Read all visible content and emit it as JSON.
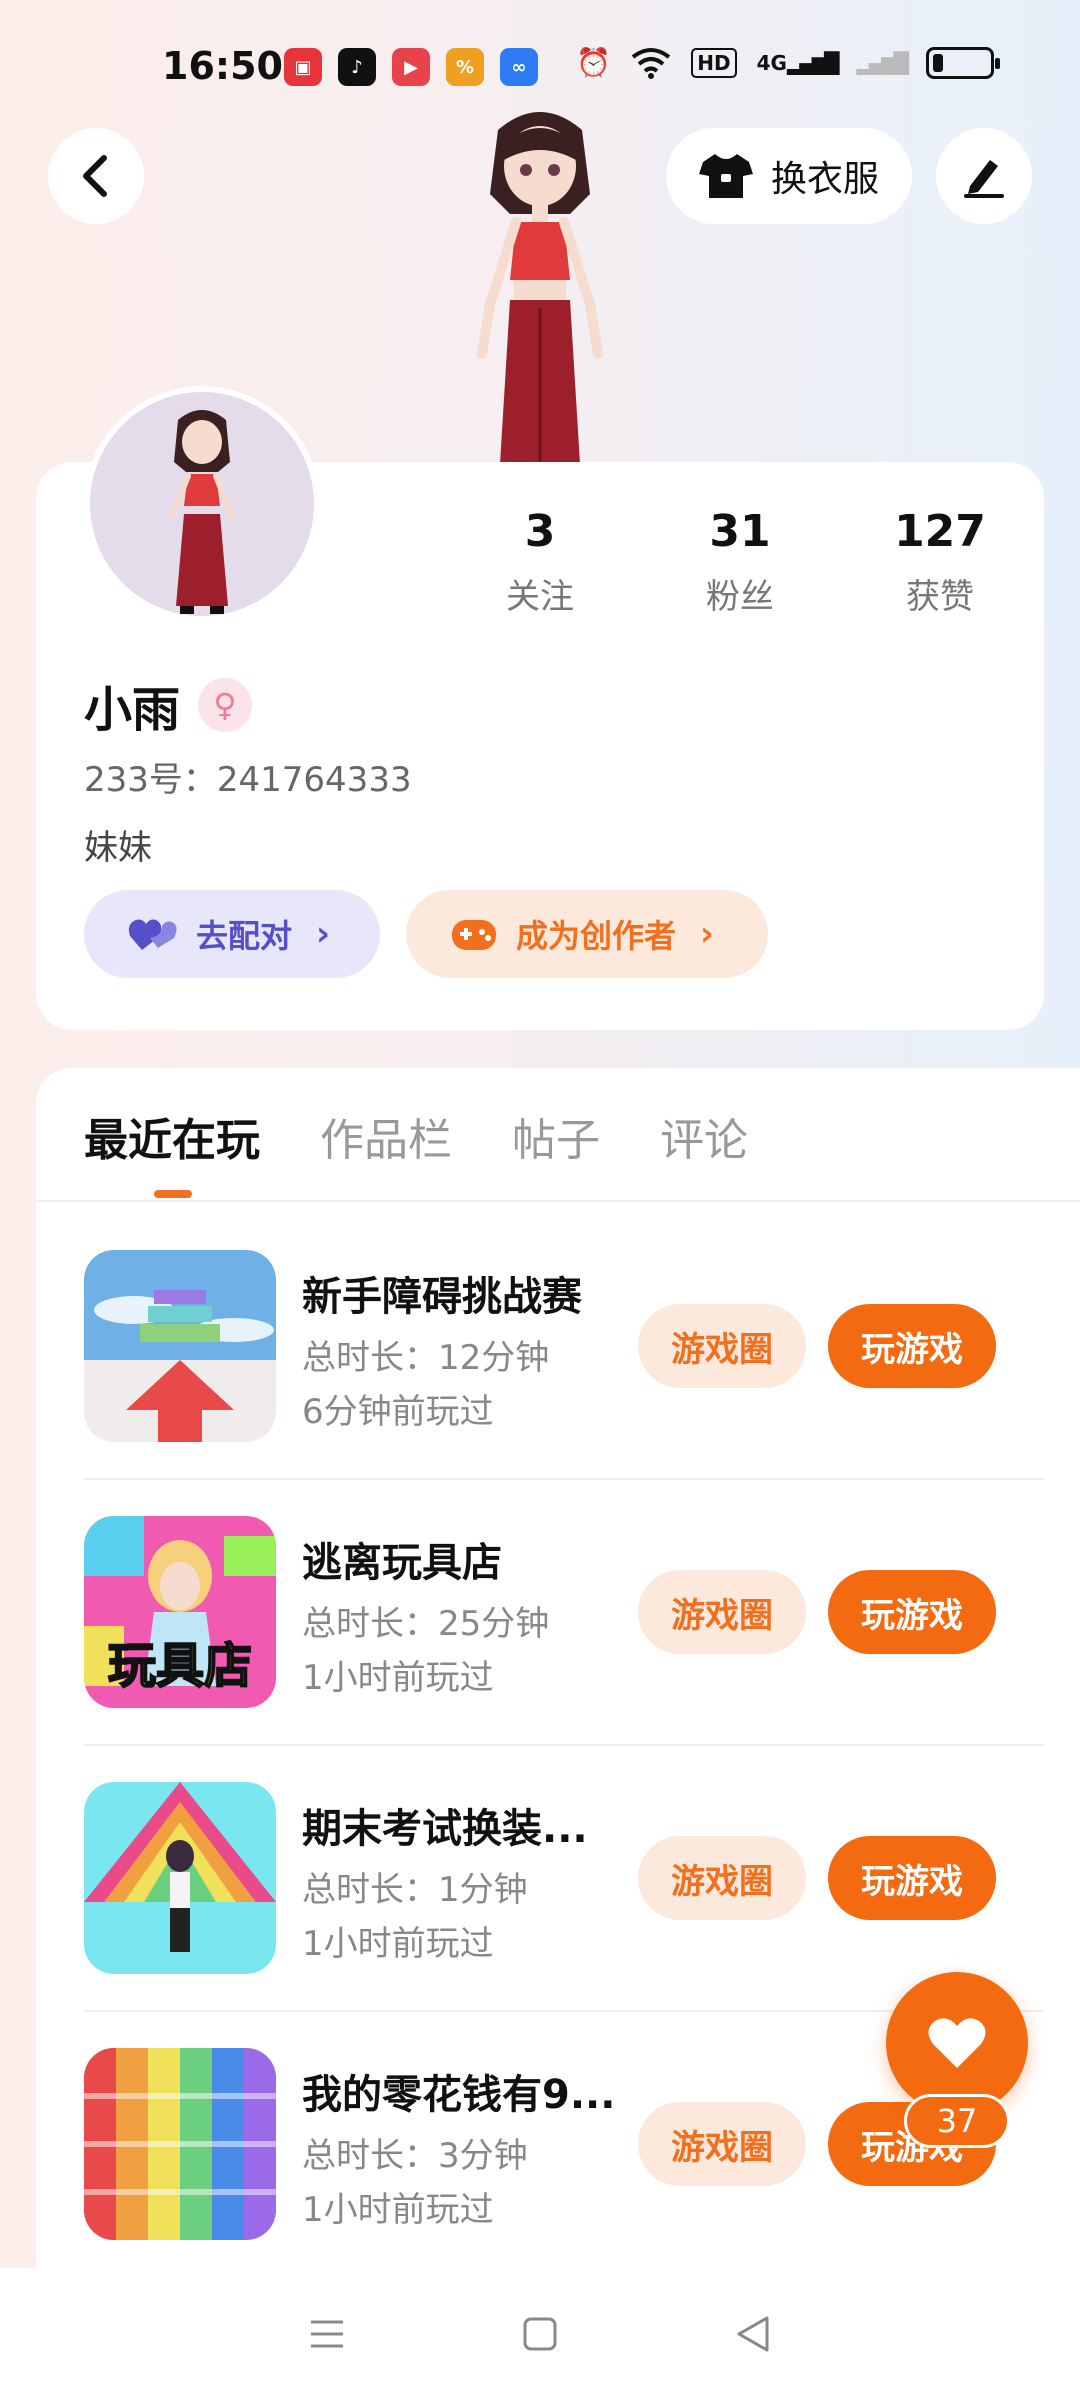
{
  "status_bar": {
    "time": "16:50",
    "apps": [
      {
        "icon": "store-app-icon",
        "color": "#e6343a"
      },
      {
        "icon": "tiktok-icon",
        "color": "#111111"
      },
      {
        "icon": "video-app-icon",
        "color": "#e8424a"
      },
      {
        "icon": "coupon-app-icon",
        "color": "#f0a020"
      },
      {
        "icon": "infinity-app-icon",
        "color": "#2d7cf6"
      }
    ],
    "hd_label": "HD",
    "network_label": "4G"
  },
  "header": {
    "outfit_label": "换衣服"
  },
  "profile": {
    "name": "小雨",
    "id_text": "233号：241764333",
    "bio": "妹妹",
    "stats": [
      {
        "value": "3",
        "label": "关注"
      },
      {
        "value": "31",
        "label": "粉丝"
      },
      {
        "value": "127",
        "label": "获赞"
      }
    ],
    "match_label": "去配对",
    "creator_label": "成为创作者"
  },
  "tabs": {
    "items": [
      "最近在玩",
      "作品栏",
      "帖子",
      "评论"
    ],
    "active": "最近在玩"
  },
  "games": [
    {
      "title": "新手障碍挑战赛",
      "duration": "总时长：12分钟",
      "last_played": "6分钟前玩过",
      "circle_label": "游戏圈",
      "play_label": "玩游戏",
      "thumb_overlay": ""
    },
    {
      "title": "逃离玩具店",
      "duration": "总时长：25分钟",
      "last_played": "1小时前玩过",
      "circle_label": "游戏圈",
      "play_label": "玩游戏",
      "thumb_overlay": "玩具店"
    },
    {
      "title": "期末考试换装...",
      "duration": "总时长：1分钟",
      "last_played": "1小时前玩过",
      "circle_label": "游戏圈",
      "play_label": "玩游戏",
      "thumb_overlay": ""
    },
    {
      "title": "我的零花钱有9...",
      "duration": "总时长：3分钟",
      "last_played": "1小时前玩过",
      "circle_label": "游戏圈",
      "play_label": "玩游戏",
      "thumb_overlay": ""
    }
  ],
  "like_fab": {
    "count": "37"
  },
  "colors": {
    "accent": "#f36a10",
    "accent_soft": "#fde9dc",
    "match_soft": "#e8e6fb",
    "match_text": "#5550c8"
  }
}
